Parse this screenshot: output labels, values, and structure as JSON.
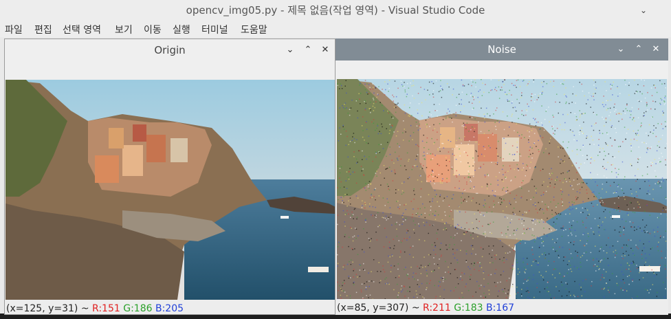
{
  "vscode": {
    "title": "opencv_img05.py - 제목 없음(작업 영역) - Visual Studio Code",
    "menu": [
      "파일",
      "편집",
      "선택 영역",
      "보기",
      "이동",
      "실행",
      "터미널",
      "도움말"
    ]
  },
  "windows": [
    {
      "title": "Origin",
      "status": {
        "coords": "(x=125, y=31) ~",
        "r": "R:151",
        "g": "G:186",
        "b": "B:205"
      }
    },
    {
      "title": "Noise",
      "status": {
        "coords": "(x=85, y=307) ~",
        "r": "R:211",
        "g": "G:183",
        "b": "B:167"
      }
    }
  ],
  "colors": {
    "active_titlebar": "#818c95",
    "status_r": "#e02020",
    "status_g": "#2aa02a",
    "status_b": "#1f3fd8"
  },
  "icons": [
    "chevron-down-icon",
    "chevron-up-icon",
    "close-icon"
  ]
}
